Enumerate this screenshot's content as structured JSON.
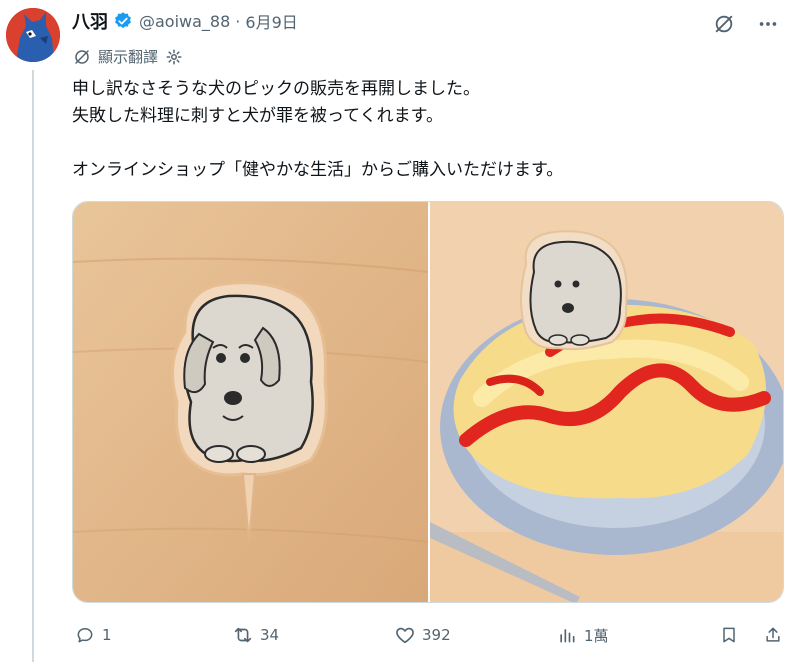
{
  "user": {
    "display_name": "八羽",
    "handle": "@aoiwa_88",
    "separator": "·",
    "date": "6月9日",
    "avatar_icon": "blue-dog-avatar-icon",
    "verified_icon": "verified-badge-icon"
  },
  "translate": {
    "label": "顯示翻譯"
  },
  "tweet": {
    "lines": [
      "申し訳なさそうな犬のピックの販売を再開しました。",
      "失敗した料理に刺すと犬が罪を被ってくれます。",
      "オンラインショップ「健やかな生活」からご購入いただけます。"
    ]
  },
  "media": {
    "left_image": "dog-pick-on-wood-image",
    "right_image": "dog-pick-on-omelette-image"
  },
  "actions": {
    "replies": "1",
    "retweets": "34",
    "likes": "392",
    "views": "1萬"
  },
  "colors": {
    "accent": "#1d9bf0",
    "muted": "#536471",
    "text": "#0f1419"
  }
}
